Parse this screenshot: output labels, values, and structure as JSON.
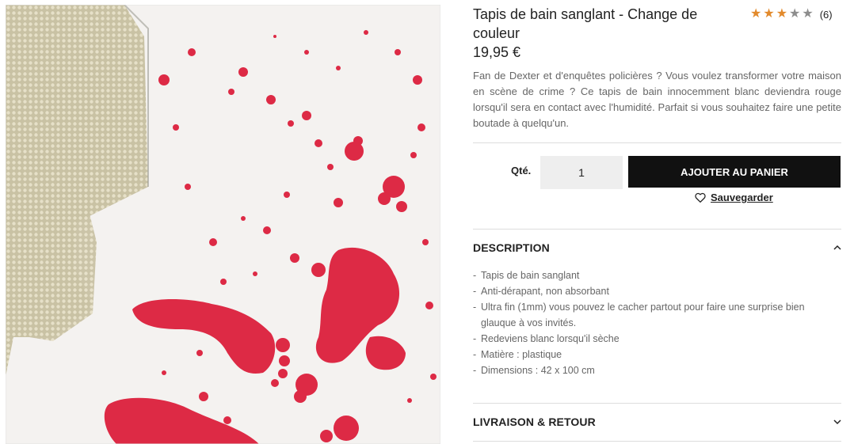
{
  "product": {
    "title": "Tapis de bain sanglant - Change de couleur",
    "price": "19,95 €",
    "rating": {
      "value": 3,
      "max": 5,
      "count_label": "(6)"
    },
    "description": "Fan de Dexter et d'enquêtes policières ? Vous voulez transformer votre maison en scène de crime ? Ce tapis de bain innocemment blanc deviendra rouge lorsqu'il sera en contact avec l'humidité. Parfait si vous souhaitez faire une petite boutade à quelqu'un.",
    "image_alt": "bath-mat-blood-splatter"
  },
  "purchase": {
    "qty_label": "Qté.",
    "qty_value": "1",
    "add_to_cart_label": "AJOUTER AU PANIER",
    "save_label": "Sauvegarder",
    "save_icon": "heart-icon"
  },
  "sections": {
    "description": {
      "title": "DESCRIPTION",
      "expanded": true,
      "items": [
        "Tapis de bain sanglant",
        "Anti-dérapant, non absorbant",
        "Ultra fin (1mm) vous pouvez le cacher partout pour faire une surprise bien glauque à vos invités.",
        "Redeviens blanc lorsqu'il sèche",
        "Matière : plastique",
        "Dimensions : 42 x 100 cm"
      ]
    },
    "shipping": {
      "title": "LIVRAISON & RETOUR",
      "expanded": false
    }
  },
  "colors": {
    "accent_star": "#e28a2c",
    "button_bg": "#111111",
    "blood_red": "#dd2a45"
  }
}
